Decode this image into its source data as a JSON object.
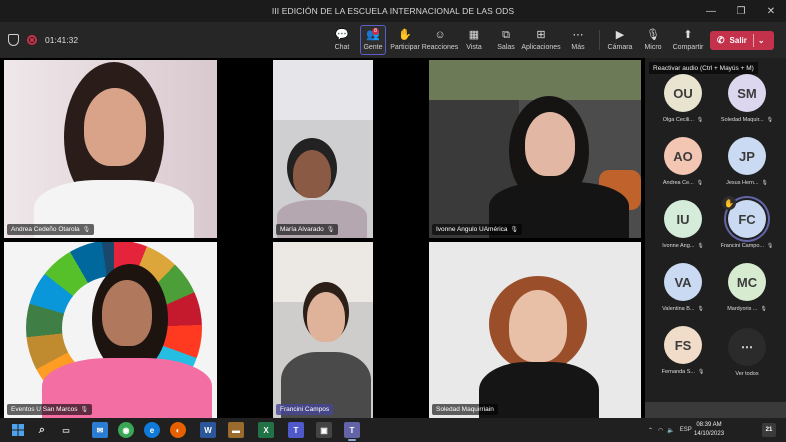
{
  "window": {
    "title": "III EDICIÓN DE LA ESCUELA INTERNACIONAL DE LAS ODS",
    "controls": [
      "—",
      "❐",
      "✕"
    ]
  },
  "toolbar": {
    "timer": "01:41:32",
    "buttons": [
      {
        "label": "Chat",
        "icon": "chat-icon",
        "glyph": "💬"
      },
      {
        "label": "Gente",
        "icon": "people-icon",
        "glyph": "👥"
      },
      {
        "label": "Participar",
        "icon": "raise-hand-icon",
        "glyph": "✋"
      },
      {
        "label": "Reacciones",
        "icon": "smiley-icon",
        "glyph": "☺"
      },
      {
        "label": "Vista",
        "icon": "grid-view-icon",
        "glyph": "▦"
      },
      {
        "label": "Salas",
        "icon": "breakout-rooms-icon",
        "glyph": "⧉"
      },
      {
        "label": "Aplicaciones",
        "icon": "add-apps-icon",
        "glyph": "⊞"
      },
      {
        "label": "Más",
        "icon": "more-icon",
        "glyph": "⋯"
      },
      {
        "label": "Cámara",
        "icon": "camera-icon",
        "glyph": "▶"
      },
      {
        "label": "Micro",
        "icon": "mic-muted-icon",
        "glyph": "🎙"
      },
      {
        "label": "Compartir",
        "icon": "share-icon",
        "glyph": "⬆"
      }
    ],
    "leave_label": "Salir",
    "people_badge": "8"
  },
  "tiles": [
    {
      "name": "Andrea Cedeño Otarola"
    },
    {
      "name": "María  Alvarado"
    },
    {
      "name": "Ivonne Angulo UAmérica"
    },
    {
      "name": "Eventos U San Marcos"
    },
    {
      "name": "Francini Campos"
    },
    {
      "name": "Soledad Maquirriain"
    }
  ],
  "sidebar": {
    "tooltip": "Reactivar audio (Ctrl + Mayús + M)",
    "participants": [
      {
        "initials": "OU",
        "name": "Olga Cecili...",
        "color": "#e8e4cf"
      },
      {
        "initials": "SM",
        "name": "Soledad Maquir...",
        "color": "#dcd7ef"
      },
      {
        "initials": "AO",
        "name": "Andrea Ce...",
        "color": "#f3c6b4"
      },
      {
        "initials": "JP",
        "name": "Jesus Hern...",
        "color": "#c9daf2"
      },
      {
        "initials": "IU",
        "name": "Ivonne Ang...",
        "color": "#d4ecd9"
      },
      {
        "initials": "FC",
        "name": "Francini Campo...",
        "color": "#c9daf2"
      },
      {
        "initials": "VA",
        "name": "Valentina B...",
        "color": "#c9daf2"
      },
      {
        "initials": "MC",
        "name": "Mardyoris ...",
        "color": "#d6ebd0"
      },
      {
        "initials": "FS",
        "name": "Fernanda S...",
        "color": "#f1dcc9"
      }
    ],
    "see_all": "Ver todos"
  },
  "taskbar": {
    "language": "ESP",
    "time": "08:39 AM",
    "date": "14/10/2023",
    "notifications": "21"
  }
}
